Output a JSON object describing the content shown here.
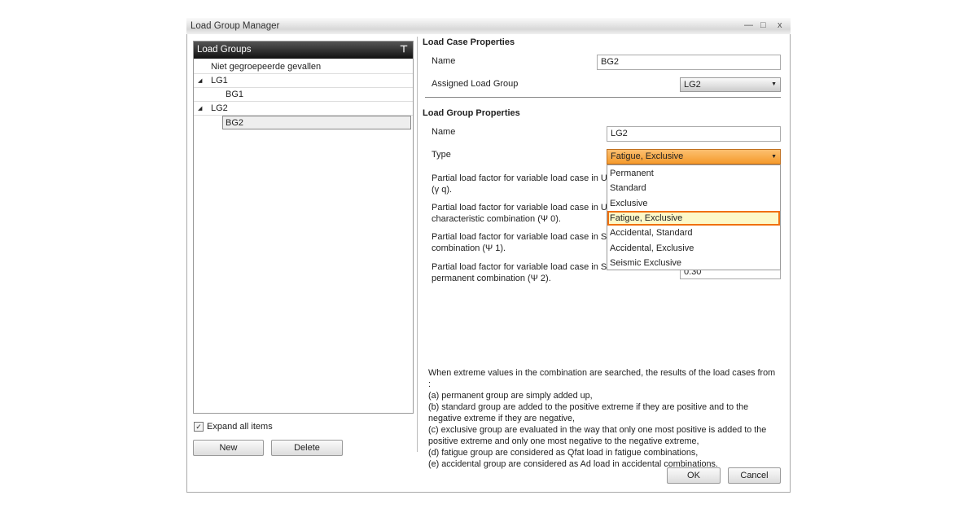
{
  "window": {
    "title": "Load Group Manager",
    "minimize": "—",
    "maximize": "□",
    "close": "x"
  },
  "left": {
    "header": "Load Groups",
    "filter_icon": "filter-icon",
    "tree": [
      {
        "label": "Niet gegroepeerde gevallen",
        "level": 0,
        "expander": false
      },
      {
        "label": "LG1",
        "level": 0,
        "expander": true
      },
      {
        "label": "BG1",
        "level": 1,
        "expander": false
      },
      {
        "label": "LG2",
        "level": 0,
        "expander": true
      },
      {
        "label": "BG2",
        "level": 1,
        "expander": false,
        "selected": true
      }
    ],
    "expander_glyph": "◢",
    "expand_all_label": "Expand all items",
    "expand_all_checked": true,
    "new_label": "New",
    "delete_label": "Delete"
  },
  "load_case": {
    "title": "Load Case Properties",
    "name_label": "Name",
    "name_value": "BG2",
    "assigned_label": "Assigned Load Group",
    "assigned_value": "LG2"
  },
  "load_group": {
    "title": "Load Group Properties",
    "name_label": "Name",
    "name_value": "LG2",
    "type_label": "Type",
    "type_value": "Fatigue, Exclusive",
    "type_options": [
      "Permanent",
      "Standard",
      "Exclusive",
      "Fatigue, Exclusive",
      "Accidental, Standard",
      "Accidental, Exclusive",
      "Seismic Exclusive"
    ],
    "factors": [
      "Partial load factor for variable load case in ULS\n(γ q).",
      "Partial load factor for variable load case in ULS\ncharacteristic combination (Ψ 0).",
      "Partial load factor for variable load case in SLS\ncombination (Ψ 1).",
      "Partial load factor for variable load case in SLS\npermanent combination (Ψ 2)."
    ],
    "psi2_value": "0.30"
  },
  "help_text": "When extreme values in the combination are searched, the results of the load cases from :\n (a) permanent group are simply added up,\n (b) standard group are added to the positive extreme if they are positive and to the negative extreme if they are negative,\n (c) exclusive group are evaluated in the way that only one most positive is added to the positive extreme and only one most negative to the negative extreme,\n (d) fatigue group are considered as Qfat load in fatigue combinations,\n (e) accidental group are considered as Ad load in accidental combinations.",
  "ok_label": "OK",
  "cancel_label": "Cancel",
  "colors": {
    "accent": "#f59a2c",
    "highlight_border": "#f07010",
    "highlight_bg": "#fdf8c8"
  }
}
